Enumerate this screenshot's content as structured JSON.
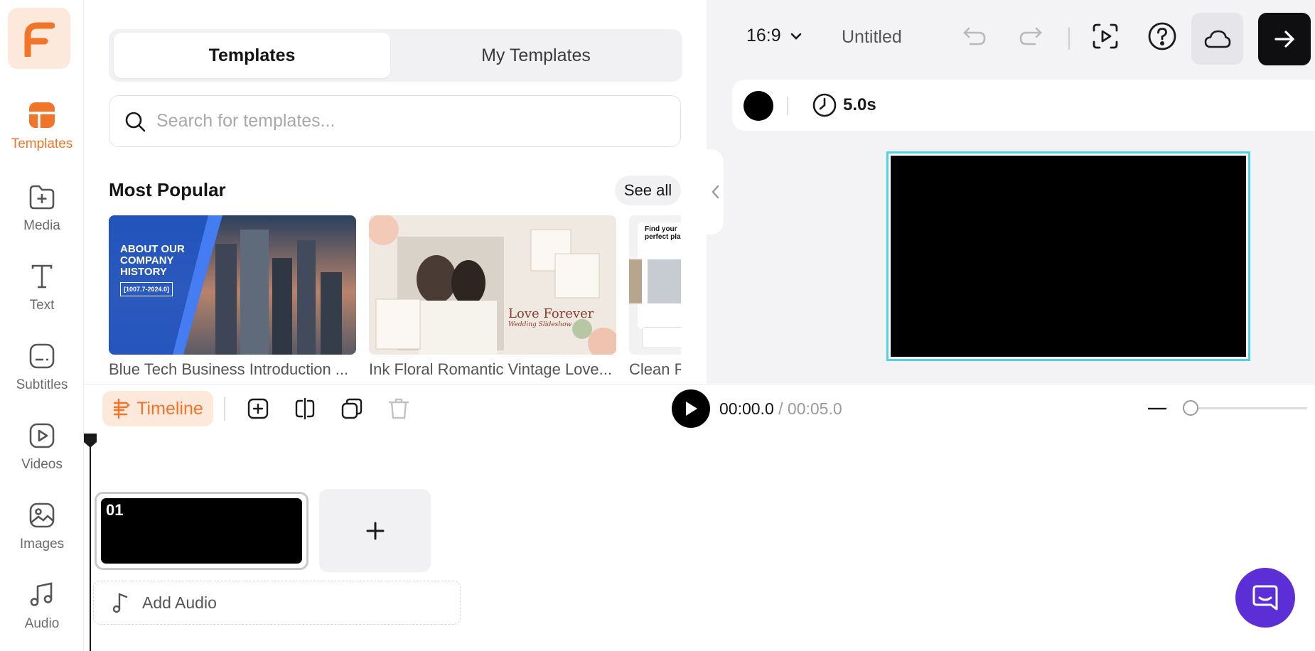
{
  "sidebar": {
    "items": [
      {
        "label": "Templates",
        "icon": "templates-icon",
        "active": true
      },
      {
        "label": "Media",
        "icon": "media-icon"
      },
      {
        "label": "Text",
        "icon": "text-icon"
      },
      {
        "label": "Subtitles",
        "icon": "subtitles-icon"
      },
      {
        "label": "Videos",
        "icon": "videos-icon"
      },
      {
        "label": "Images",
        "icon": "images-icon"
      },
      {
        "label": "Audio",
        "icon": "audio-icon"
      }
    ]
  },
  "templates_panel": {
    "tabs": [
      {
        "label": "Templates",
        "active": true
      },
      {
        "label": "My Templates",
        "active": false
      }
    ],
    "search": {
      "placeholder": "Search for templates..."
    },
    "section_title": "Most Popular",
    "see_all": "See all",
    "cards": [
      {
        "caption": "Blue Tech Business Introduction ...",
        "thumb_text": [
          "ABOUT OUR",
          "COMPANY",
          "HISTORY",
          "[1007.7-2024.0]"
        ]
      },
      {
        "caption": "Ink Floral Romantic Vintage Love...",
        "thumb_text": [
          "Love Forever",
          "Wedding Slideshow"
        ]
      },
      {
        "caption": "Clean R",
        "thumb_text": [
          "Find your",
          "perfect plac"
        ]
      }
    ]
  },
  "topbar": {
    "aspect_ratio": "16:9",
    "title": "Untitled"
  },
  "properties": {
    "background_color": "#000000",
    "duration": "5.0s"
  },
  "timeline": {
    "label": "Timeline",
    "current_time": "00:00.0",
    "separator": " / ",
    "total_time": "00:05.0",
    "clips": [
      {
        "number": "01"
      }
    ],
    "add_audio": "Add Audio"
  },
  "colors": {
    "accent": "#f0752a",
    "accent_bg": "#fde8dc",
    "selection": "#52d2e6",
    "chat": "#5c2ed6"
  }
}
